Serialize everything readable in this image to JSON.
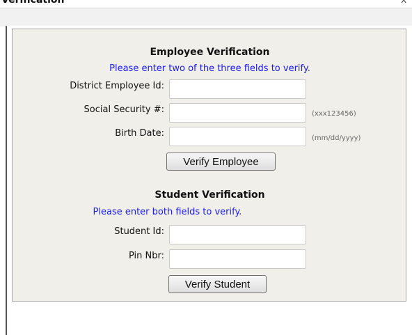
{
  "window": {
    "title": "Verification",
    "close_glyph": "x"
  },
  "employee": {
    "heading": "Employee Verification",
    "instruction": "Please enter two of the three fields to verify.",
    "fields": [
      {
        "label": "District Employee Id:",
        "value": "",
        "hint": ""
      },
      {
        "label": "Social Security #:",
        "value": "",
        "hint": "(xxx123456)"
      },
      {
        "label": "Birth Date:",
        "value": "",
        "hint": "(mm/dd/yyyy)"
      }
    ],
    "button_label": "Verify Employee"
  },
  "student": {
    "heading": "Student Verification",
    "instruction": "Please enter both fields to verify.",
    "fields": [
      {
        "label": "Student Id:",
        "value": ""
      },
      {
        "label": "Pin Nbr:",
        "value": ""
      }
    ],
    "button_label": "Verify Student"
  },
  "colors": {
    "instruction_text": "#1a1aff",
    "panel_background": "#f0efe9",
    "panel_border": "#a8a8a8"
  },
  "icons": {
    "close": "close-icon"
  }
}
